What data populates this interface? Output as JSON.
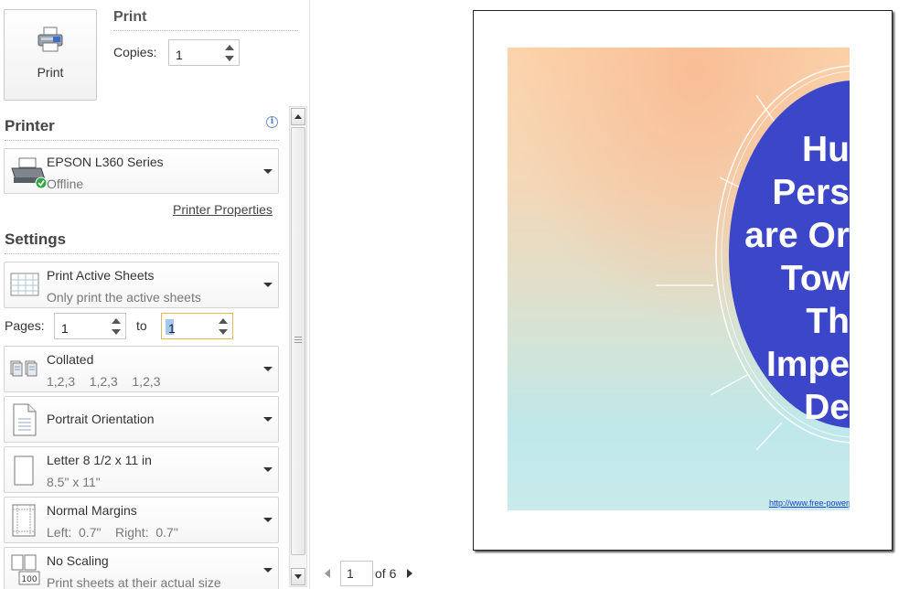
{
  "print": {
    "button_label": "Print",
    "section_title": "Print",
    "copies_label": "Copies:",
    "copies_value": "1"
  },
  "printer": {
    "section_title": "Printer",
    "name": "EPSON L360 Series",
    "status": "Offline",
    "properties_link": "Printer Properties",
    "info_glyph": "i"
  },
  "settings": {
    "section_title": "Settings",
    "what": {
      "title": "Print Active Sheets",
      "subtitle": "Only print the active sheets"
    },
    "pages_label": "Pages:",
    "pages_from": "1",
    "to_label": "to",
    "pages_to": "1",
    "collation": {
      "title": "Collated",
      "subtitle": "1,2,3    1,2,3    1,2,3"
    },
    "orientation": {
      "title": "Portrait Orientation"
    },
    "paper": {
      "title": "Letter 8 1/2 x 11 in",
      "subtitle": "8.5\" x 11\""
    },
    "margins": {
      "title": "Normal Margins",
      "subtitle": "Left:  0.7\"    Right:  0.7\""
    },
    "scaling": {
      "title": "No Scaling",
      "subtitle": "Print sheets at their actual size",
      "icon_text": "100"
    }
  },
  "preview": {
    "slide_words": [
      "Hu",
      "Pers",
      "are Or",
      "Tow",
      "Th",
      "Impe",
      "De"
    ],
    "slide_url": "http://www.free-powerp",
    "colors": {
      "circle": "#3b46c8",
      "text": "#ffffff",
      "link": "#1a3fd0"
    }
  },
  "pager": {
    "current_page": "1",
    "of_label": "of 6"
  },
  "icons": {
    "print_button": "printer-icon",
    "printer": "printer-status-icon",
    "sheets": "sheets-icon",
    "collate": "collate-icon",
    "orientation": "portrait-page-icon",
    "paper": "paper-size-icon",
    "margins": "margins-icon",
    "scaling": "scaling-icon"
  }
}
